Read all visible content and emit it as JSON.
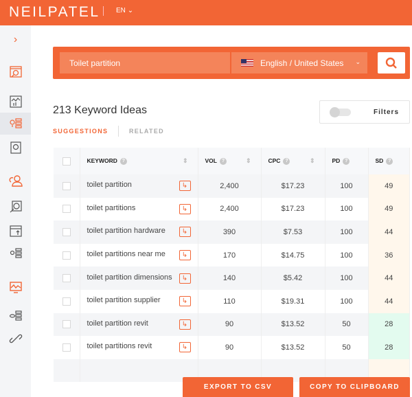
{
  "header": {
    "logo": "NEILPATEL",
    "language": "EN"
  },
  "search": {
    "keyword": "Toilet partition",
    "location": "English / United States"
  },
  "results": {
    "title": "213 Keyword Ideas",
    "tabs": [
      "SUGGESTIONS",
      "RELATED"
    ],
    "filters_label": "Filters"
  },
  "table": {
    "headers": [
      "KEYWORD",
      "VOL",
      "CPC",
      "PD",
      "SD"
    ],
    "rows": [
      {
        "keyword": "toilet partition",
        "vol": "2,400",
        "cpc": "$17.23",
        "pd": "100",
        "sd": "49"
      },
      {
        "keyword": "toilet partitions",
        "vol": "2,400",
        "cpc": "$17.23",
        "pd": "100",
        "sd": "49"
      },
      {
        "keyword": "toilet partition hardware",
        "vol": "390",
        "cpc": "$7.53",
        "pd": "100",
        "sd": "44"
      },
      {
        "keyword": "toilet partitions near me",
        "vol": "170",
        "cpc": "$14.75",
        "pd": "100",
        "sd": "36"
      },
      {
        "keyword": "toilet partition dimensions",
        "vol": "140",
        "cpc": "$5.42",
        "pd": "100",
        "sd": "44"
      },
      {
        "keyword": "toilet partition supplier",
        "vol": "110",
        "cpc": "$19.31",
        "pd": "100",
        "sd": "44"
      },
      {
        "keyword": "toilet partition revit",
        "vol": "90",
        "cpc": "$13.52",
        "pd": "50",
        "sd": "28"
      },
      {
        "keyword": "toilet partitions revit",
        "vol": "90",
        "cpc": "$13.52",
        "pd": "50",
        "sd": "28"
      }
    ]
  },
  "buttons": {
    "export": "EXPORT TO CSV",
    "copy": "COPY TO CLIPBOARD"
  },
  "colors": {
    "brand": "#f26535",
    "sd_medium": "#fff7ec",
    "sd_easy": "#e3fbef"
  }
}
